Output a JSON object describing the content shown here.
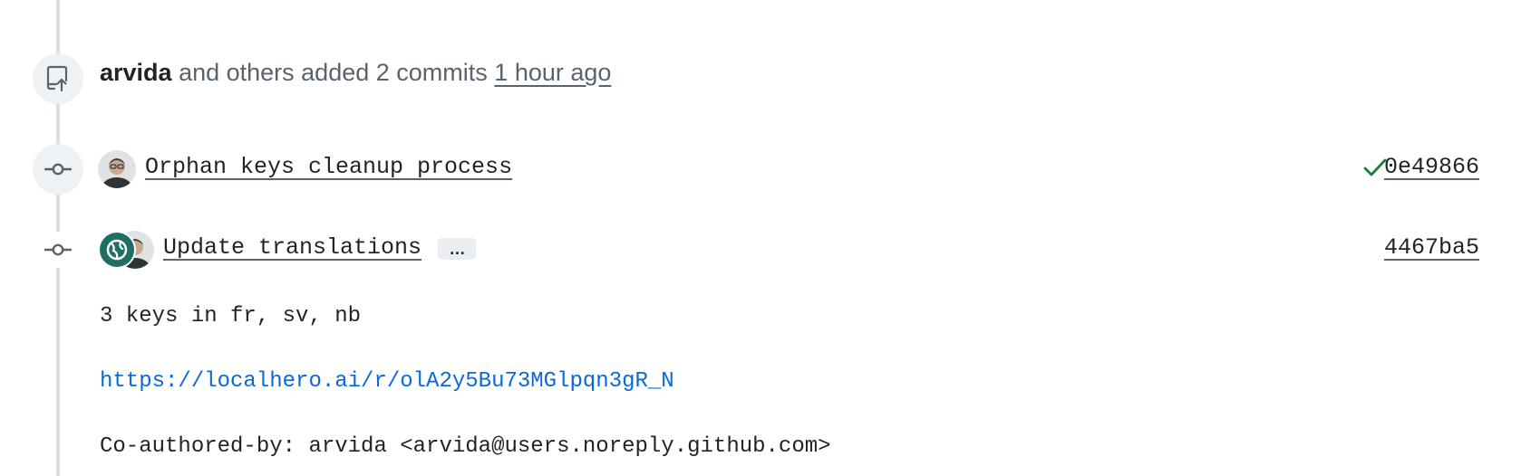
{
  "event": {
    "author": "arvida",
    "text": "and others added 2 commits",
    "time": "1 hour ago",
    "icon": "repo-push-icon"
  },
  "commits": [
    {
      "title": "Orphan keys cleanup process",
      "sha": "0e49866",
      "status": "success",
      "status_color": "#1a7f37"
    },
    {
      "title": "Update translations",
      "sha": "4467ba5",
      "expand_label": "…",
      "body": {
        "summary": "3 keys in fr, sv, nb",
        "link": "https://localhero.ai/r/olA2y5Bu73MGlpqn3gR_N",
        "coauthor": "Co-authored-by: arvida <arvida@users.noreply.github.com>"
      }
    }
  ],
  "colors": {
    "link": "#0969da",
    "timeline": "#d8dee4",
    "badge_bg": "#eff2f5",
    "bot_avatar": "#1f6f64"
  }
}
